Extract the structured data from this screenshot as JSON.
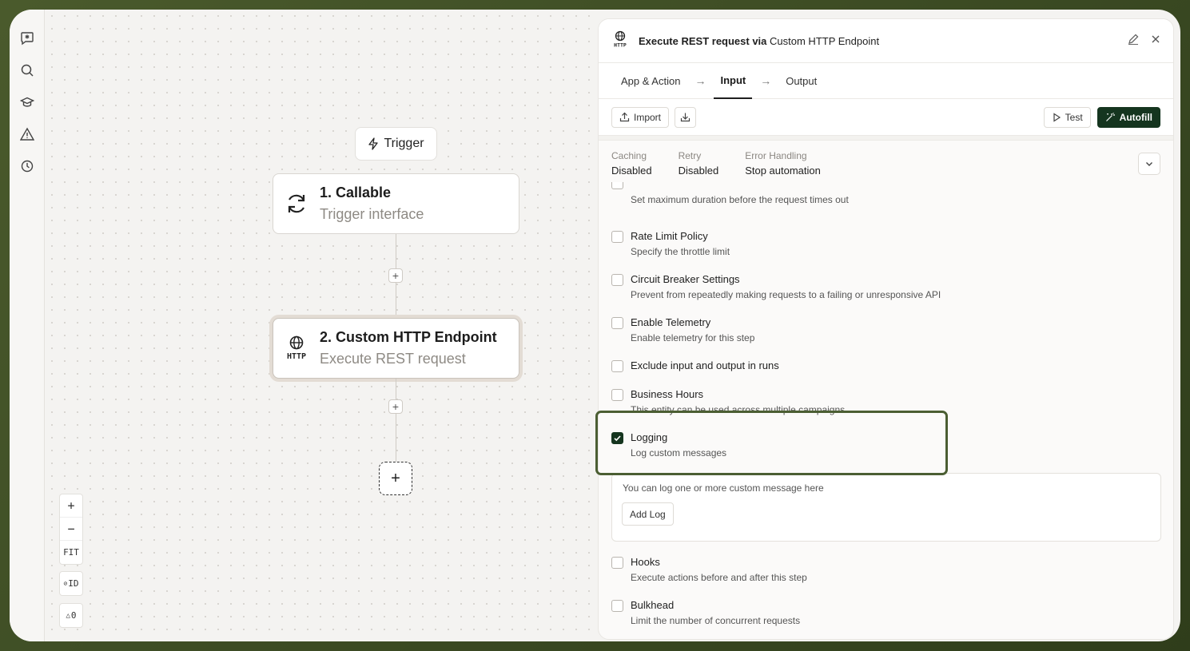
{
  "canvas": {
    "trigger_label": "Trigger",
    "node1": {
      "title": "1. Callable",
      "subtitle": "Trigger interface"
    },
    "node2": {
      "title": "2. Custom HTTP Endpoint",
      "subtitle": "Execute REST request"
    },
    "add_symbol": "+",
    "zoom": {
      "in": "+",
      "out": "−",
      "fit": "FIT",
      "id_toggle": "ID",
      "warnings": "0"
    }
  },
  "panel": {
    "title_bold": "Execute REST request via",
    "title_rest": "Custom HTTP Endpoint",
    "tabs": [
      {
        "label": "App & Action"
      },
      {
        "label": "Input"
      },
      {
        "label": "Output"
      }
    ],
    "toolbar": {
      "import": "Import",
      "test": "Test",
      "autofill": "Autofill"
    },
    "settings": [
      {
        "key": "Caching",
        "value": "Disabled"
      },
      {
        "key": "Retry",
        "value": "Disabled"
      },
      {
        "key": "Error Handling",
        "value": "Stop automation"
      }
    ],
    "options": [
      {
        "label": "",
        "desc": "Set maximum duration before the request times out",
        "checked": false
      },
      {
        "label": "Rate Limit Policy",
        "desc": "Specify the throttle limit",
        "checked": false
      },
      {
        "label": "Circuit Breaker Settings",
        "desc": "Prevent from repeatedly making requests to a failing or unresponsive API",
        "checked": false
      },
      {
        "label": "Enable Telemetry",
        "desc": "Enable telemetry for this step",
        "checked": false
      },
      {
        "label": "Exclude input and output in runs",
        "desc": "",
        "checked": false
      },
      {
        "label": "Business Hours",
        "desc": "This entity can be used across multiple campaigns",
        "checked": false
      },
      {
        "label": "Logging",
        "desc": "Log custom messages",
        "checked": true
      },
      {
        "label": "Hooks",
        "desc": "Execute actions before and after this step",
        "checked": false
      },
      {
        "label": "Bulkhead",
        "desc": "Limit the number of concurrent requests",
        "checked": false
      }
    ],
    "logging": {
      "hint": "You can log one or more custom message here",
      "add_button": "Add Log"
    }
  },
  "colors": {
    "accent": "#15351f",
    "highlight": "#4b5e33"
  }
}
